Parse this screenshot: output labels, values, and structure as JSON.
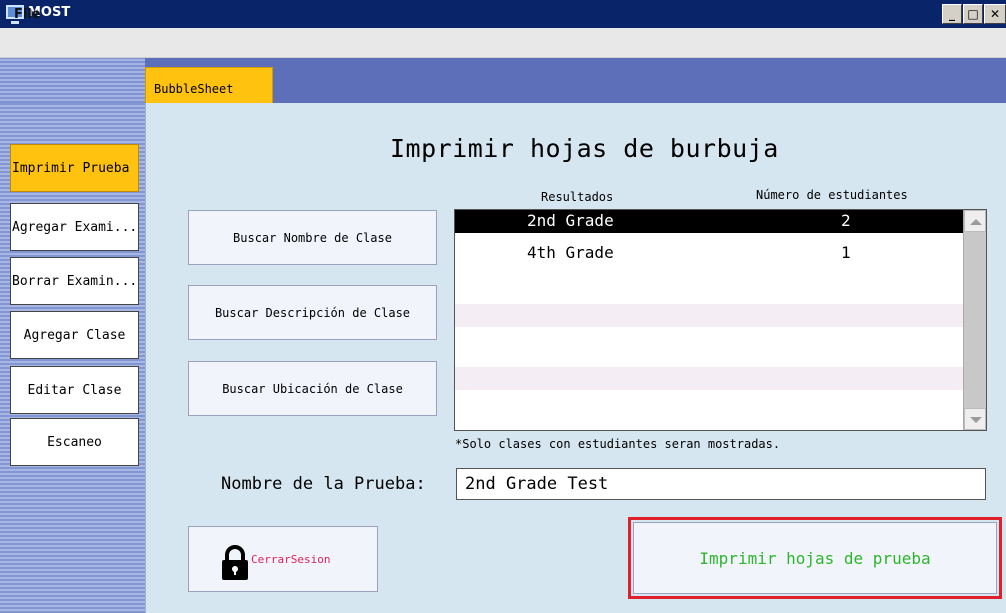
{
  "window": {
    "title": "MOST",
    "minimize_label": "_",
    "maximize_label": "□",
    "close_label": "✕"
  },
  "menu": {
    "file": "File"
  },
  "tab": {
    "label": "BubbleSheet"
  },
  "sidebar": {
    "items": [
      {
        "label": "Imprimir Prueba",
        "active": true
      },
      {
        "label": "Agregar Exami..."
      },
      {
        "label": "Borrar Examin..."
      },
      {
        "label": "Agregar Clase"
      },
      {
        "label": "Editar Clase"
      },
      {
        "label": "Escaneo"
      }
    ]
  },
  "main": {
    "heading": "Imprimir hojas de burbuja",
    "search_buttons": [
      "Buscar Nombre de Clase",
      "Buscar Descripción de Clase",
      "Buscar Ubicación de Clase"
    ],
    "results": {
      "columns": [
        "Resultados",
        "Número de estudiantes"
      ],
      "rows": [
        {
          "name": "2nd Grade",
          "count": "2",
          "selected": true
        },
        {
          "name": "4th Grade",
          "count": "1"
        }
      ]
    },
    "note": "*Solo clases con estudiantes seran mostradas.",
    "test_name_label": "Nombre de la Prueba:",
    "test_name_value": "2nd Grade Test",
    "logout_label": "CerrarSesion",
    "print_button": "Imprimir hojas de prueba"
  },
  "colors": {
    "accent_yellow": "#ffc20e",
    "print_text_green": "#2db52d",
    "logout_text_pink": "#e0205a",
    "highlight_red": "#e0202a"
  }
}
